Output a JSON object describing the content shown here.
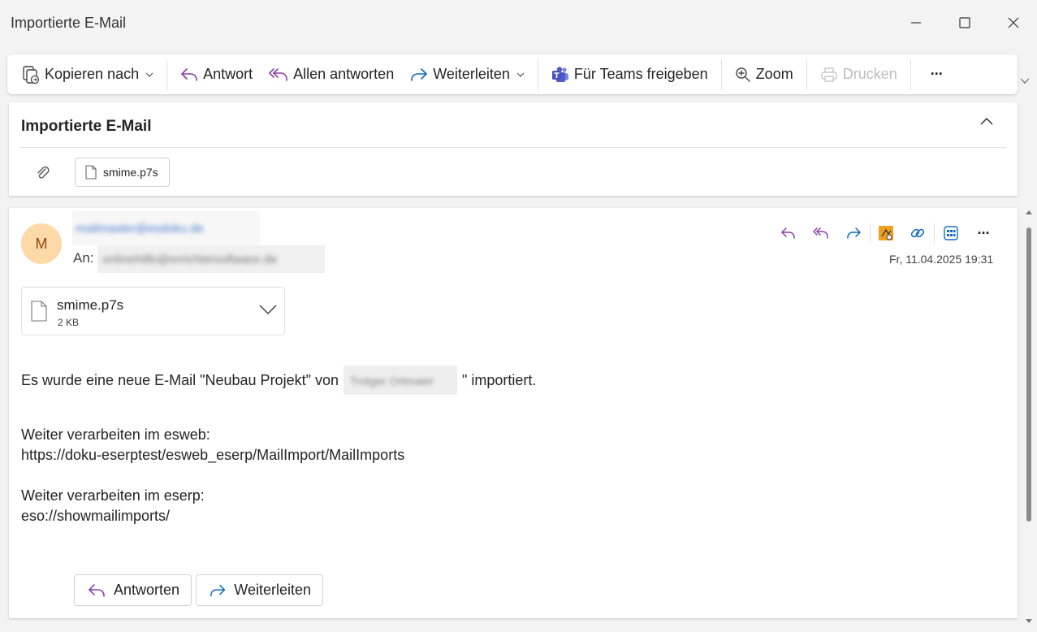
{
  "window": {
    "title": "Importierte E-Mail"
  },
  "toolbar": {
    "copy_to": "Kopieren nach",
    "reply": "Antwort",
    "reply_all": "Allen antworten",
    "forward": "Weiterleiten",
    "teams": "Für Teams freigeben",
    "zoom": "Zoom",
    "print": "Drucken",
    "more": "···"
  },
  "subject": {
    "title": "Importierte E-Mail",
    "attachment_chip": "smime.p7s"
  },
  "message": {
    "avatar_initial": "M",
    "sender_redacted": "mailmaster@esdoku.de",
    "to_label": "An:",
    "to_redacted": "onlinehilfe@errichtersoftware.de",
    "date": "Fr, 11.04.2025 19:31",
    "more": "···",
    "attachment": {
      "name": "smime.p7s",
      "size": "2 KB"
    },
    "body": {
      "line1_prefix": "Es wurde eine neue E-Mail \"Neubau Projekt\" von",
      "line1_redacted": "Trotger Ortmaier",
      "line1_suffix": "\" importiert.",
      "esweb_heading": "Weiter verarbeiten im esweb:",
      "esweb_link": "https://doku-eserptest/esweb_eserp/MailImport/MailImports",
      "eserp_heading": "Weiter verarbeiten im eserp:",
      "eserp_link": "eso://showmailimports/"
    },
    "reply_button": "Antworten",
    "forward_button": "Weiterleiten"
  },
  "colors": {
    "accent_purple": "#8a3fa8",
    "accent_blue": "#0f6cbd",
    "avatar_bg": "#fdd9a8",
    "avatar_fg": "#8a4b08"
  }
}
